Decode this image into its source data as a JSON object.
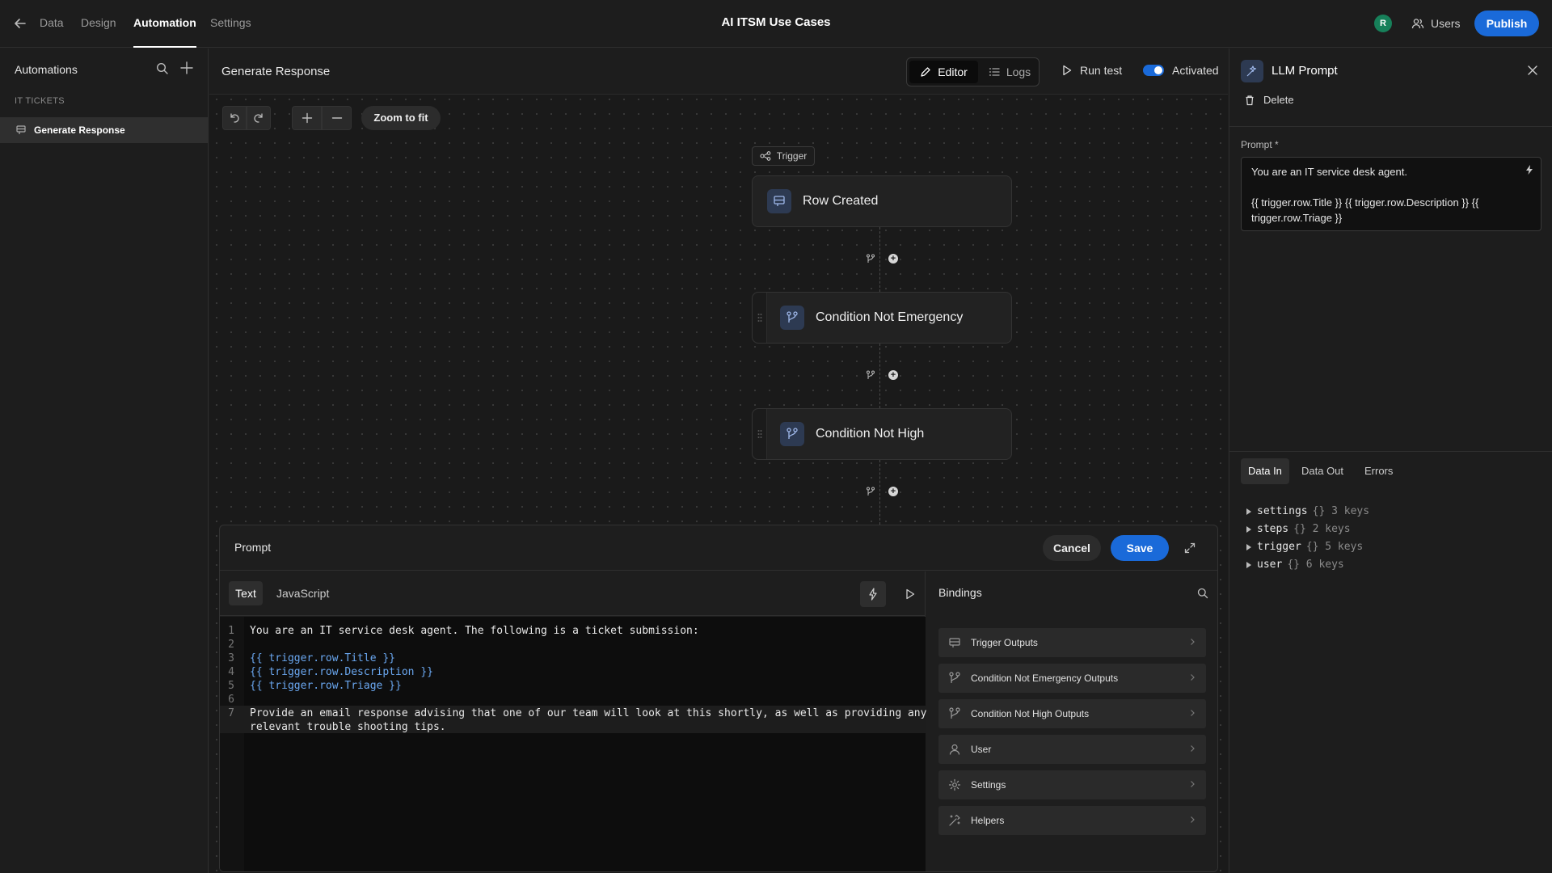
{
  "topbar": {
    "tabs": [
      {
        "label": "Data"
      },
      {
        "label": "Design"
      },
      {
        "label": "Automation"
      },
      {
        "label": "Settings"
      }
    ],
    "app_title": "AI ITSM Use Cases",
    "avatar_initial": "R",
    "avatar_color": "#17805a",
    "users_label": "Users",
    "publish_label": "Publish",
    "accent_color": "#1a6ad9"
  },
  "sidebar": {
    "title": "Automations",
    "section": "IT TICKETS",
    "items": [
      {
        "label": "Generate Response"
      }
    ]
  },
  "canvas": {
    "title": "Generate Response",
    "editor_label": "Editor",
    "logs_label": "Logs",
    "run_test_label": "Run test",
    "activated_label": "Activated",
    "zoom_fit_label": "Zoom to fit",
    "trigger_tag": "Trigger",
    "nodes": [
      {
        "label": "Row Created"
      },
      {
        "label": "Condition Not Emergency"
      },
      {
        "label": "Condition Not High"
      }
    ]
  },
  "prompt_panel": {
    "title": "Prompt",
    "cancel_label": "Cancel",
    "save_label": "Save",
    "tab_text": "Text",
    "tab_js": "JavaScript",
    "code_lines": [
      {
        "n": "1",
        "text": "You are an IT service desk agent. The following is a ticket submission:"
      },
      {
        "n": "2",
        "text": ""
      },
      {
        "n": "3",
        "text": "{{ trigger.row.Title }}"
      },
      {
        "n": "4",
        "text": "{{ trigger.row.Description }}"
      },
      {
        "n": "5",
        "text": "{{ trigger.row.Triage }}"
      },
      {
        "n": "6",
        "text": ""
      },
      {
        "n": "7",
        "text": "Provide an email response advising that one of our team will look at this shortly, as well as providing any"
      },
      {
        "n": "",
        "text": "relevant trouble shooting tips."
      }
    ],
    "bindings_title": "Bindings",
    "bindings": [
      {
        "label": "Trigger Outputs",
        "icon": "trigger-outputs-icon"
      },
      {
        "label": "Condition Not Emergency Outputs",
        "icon": "branch-icon"
      },
      {
        "label": "Condition Not High Outputs",
        "icon": "branch-icon"
      },
      {
        "label": "User",
        "icon": "user-icon"
      },
      {
        "label": "Settings",
        "icon": "gear-icon"
      },
      {
        "label": "Helpers",
        "icon": "helpers-icon"
      }
    ]
  },
  "right_panel": {
    "title": "LLM Prompt",
    "delete_label": "Delete",
    "prompt_label": "Prompt *",
    "prompt_line1": "You are an IT service desk agent.",
    "prompt_line2": "{{ trigger.row.Title }} {{ trigger.row.Description }} {{",
    "prompt_line3": "trigger.row.Triage }}",
    "tabs": [
      {
        "label": "Data In"
      },
      {
        "label": "Data Out"
      },
      {
        "label": "Errors"
      }
    ],
    "tree": [
      {
        "key": "settings",
        "meta": "{} 3 keys"
      },
      {
        "key": "steps",
        "meta": "{} 2 keys"
      },
      {
        "key": "trigger",
        "meta": "{} 5 keys"
      },
      {
        "key": "user",
        "meta": "{} 6 keys"
      }
    ]
  }
}
